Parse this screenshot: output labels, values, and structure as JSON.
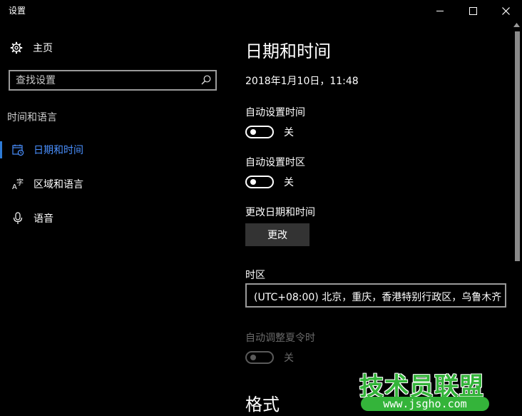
{
  "window": {
    "title": "设置"
  },
  "sidebar": {
    "home_label": "主页",
    "search": {
      "placeholder": "查找设置",
      "value": ""
    },
    "section_title": "时间和语言",
    "items": [
      {
        "label": "日期和时间",
        "icon": "calendar-clock-icon",
        "active": true
      },
      {
        "label": "区域和语言",
        "icon": "language-icon",
        "active": false
      },
      {
        "label": "语音",
        "icon": "microphone-icon",
        "active": false
      }
    ]
  },
  "main": {
    "title": "日期和时间",
    "current_datetime": "2018年1月10日，11:48",
    "auto_time": {
      "label": "自动设置时间",
      "state": "关"
    },
    "auto_timezone": {
      "label": "自动设置时区",
      "state": "关"
    },
    "change": {
      "label": "更改日期和时间",
      "button": "更改"
    },
    "timezone": {
      "label": "时区",
      "value": "(UTC+08:00) 北京，重庆，香港特别行政区，乌鲁木齐"
    },
    "dst": {
      "label": "自动调整夏令时",
      "state": "关"
    },
    "format_title": "格式"
  },
  "watermark": {
    "text": "技术员联盟",
    "url": "www.jsgho.com"
  },
  "colors": {
    "accent": "#2e7bd6",
    "active_text": "#4a90ff",
    "background": "#000000",
    "watermark": "#34b43a"
  }
}
